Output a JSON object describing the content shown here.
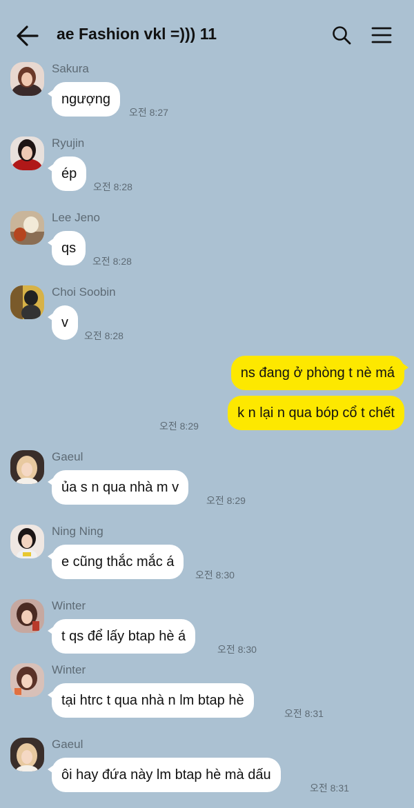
{
  "header": {
    "title": "ae Fashion vkl =))) 11",
    "back_icon": "arrow-left-icon",
    "search_icon": "search-icon",
    "menu_icon": "hamburger-menu-icon"
  },
  "messages": [
    {
      "sender": "Sakura",
      "text": "ngượng",
      "time": "오전 8:27"
    },
    {
      "sender": "Ryujin",
      "text": "ép",
      "time": "오전 8:28"
    },
    {
      "sender": "Lee Jeno",
      "text": "qs",
      "time": "오전 8:28"
    },
    {
      "sender": "Choi Soobin",
      "text": "v",
      "time": "오전 8:28"
    },
    {
      "sender": "Gaeul",
      "text": "ủa s n qua nhà m v",
      "time": "오전 8:29"
    },
    {
      "sender": "Ning Ning",
      "text": "e cũng thắc mắc á",
      "time": "오전 8:30"
    },
    {
      "sender": "Winter",
      "text": "t qs để lấy btap hè á",
      "time": "오전 8:30"
    },
    {
      "sender": "Winter",
      "text": "tại htrc t qua nhà n lm btap hè",
      "time": "오전 8:31"
    },
    {
      "sender": "Gaeul",
      "text": "ôi hay đứa này lm btap hè mà dấu",
      "time": "오전 8:31"
    }
  ],
  "outgoing": [
    {
      "text": "ns đang ở phòng t nè má"
    },
    {
      "text": "k n lại n qua bóp cổ t chết",
      "time": "오전 8:29"
    }
  ],
  "colors": {
    "background": "#abc1d2",
    "incoming_bubble": "#ffffff",
    "outgoing_bubble": "#fde800"
  }
}
